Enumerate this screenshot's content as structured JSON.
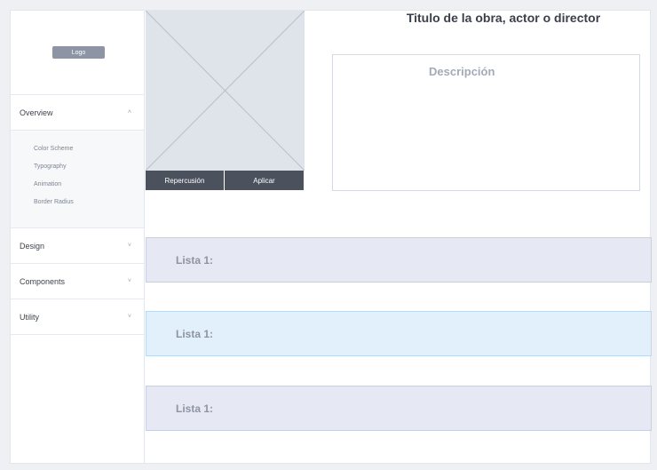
{
  "sidebar": {
    "logo_label": "Logo",
    "overview": {
      "label": "Overview",
      "chevron": "˄"
    },
    "submenu": [
      "Color Scheme",
      "Typography",
      "Animation",
      "Border Radius"
    ],
    "items": [
      {
        "label": "Design",
        "chevron": "˅"
      },
      {
        "label": "Components",
        "chevron": "˅"
      },
      {
        "label": "Utility",
        "chevron": "˅"
      }
    ]
  },
  "main": {
    "title": "Titulo de la obra, actor o director",
    "description_label": "Descripción",
    "buttons": {
      "repercusion": "Repercusión",
      "aplicar": "Aplicar"
    },
    "lists": [
      "Lista 1:",
      "Lista 1:",
      "Lista 1:"
    ]
  },
  "colors": {
    "button_bg": "#4b515d",
    "placeholder_bg": "#dfe3ea",
    "list_bg": "#e6e8f3",
    "list_active_bg": "#e1f0fb"
  }
}
